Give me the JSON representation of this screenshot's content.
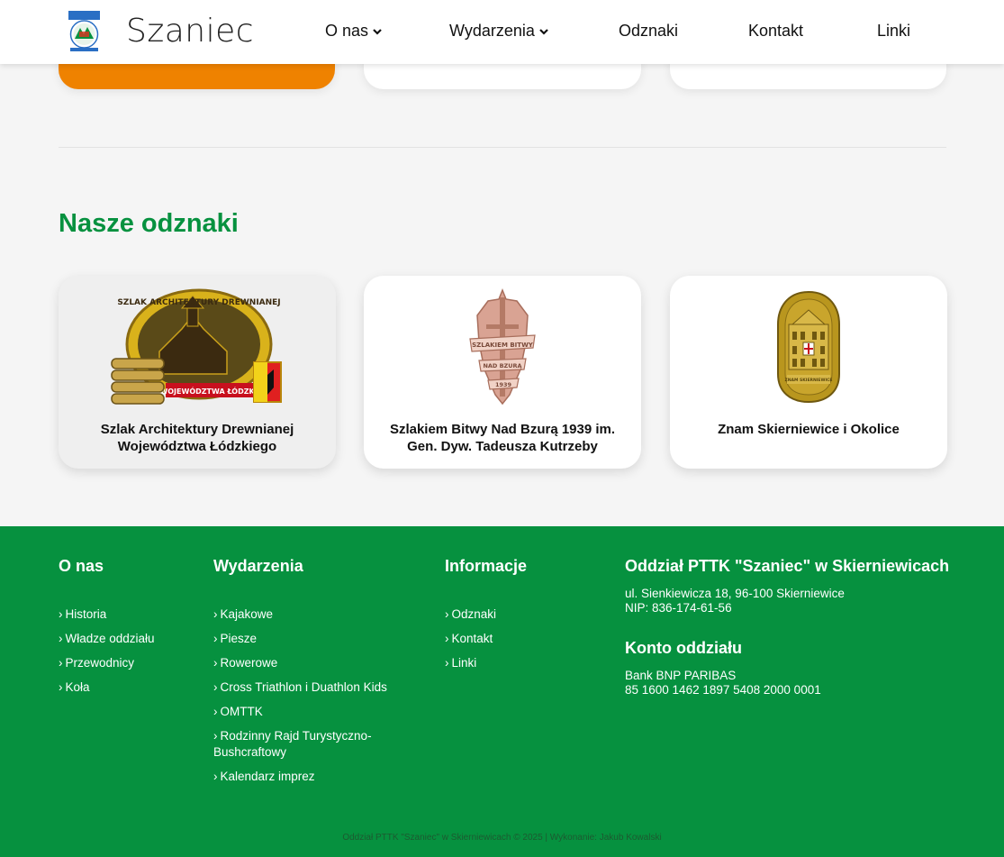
{
  "header": {
    "brand": "Szaniec",
    "nav": [
      {
        "label": "O nas",
        "dropdown": true
      },
      {
        "label": "Wydarzenia",
        "dropdown": true
      },
      {
        "label": "Odznaki",
        "dropdown": false
      },
      {
        "label": "Kontakt",
        "dropdown": false
      },
      {
        "label": "Linki",
        "dropdown": false
      }
    ]
  },
  "badges": {
    "title": "Nasze odznaki",
    "cards": [
      {
        "title": "Szlak Architektury Drewnianej Województwa Łódzkiego",
        "icon": "wooden-church-badge"
      },
      {
        "title": "Szlakiem Bitwy Nad Bzurą 1939 im. Gen. Dyw. Tadeusza Kutrzeby",
        "icon": "sword-banner-badge"
      },
      {
        "title": "Znam Skierniewice i Okolice",
        "icon": "town-hall-badge"
      }
    ]
  },
  "footer": {
    "col1": {
      "title": "O nas",
      "items": [
        "Historia",
        "Władze oddziału",
        "Przewodnicy",
        "Koła"
      ]
    },
    "col2": {
      "title": "Wydarzenia",
      "items": [
        "Kajakowe",
        "Piesze",
        "Rowerowe",
        "Cross Triathlon i Duathlon Kids",
        "OMTTK",
        "Rodzinny Rajd Turystyczno-Bushcraftowy",
        "Kalendarz imprez"
      ]
    },
    "col3": {
      "title": "Informacje",
      "items": [
        "Odznaki",
        "Kontakt",
        "Linki"
      ]
    },
    "col4": {
      "title": "Oddział PTTK \"Szaniec\" w Skierniewicach",
      "address": "ul. Sienkiewicza 18, 96-100 Skierniewice",
      "nip": "NIP: 836-174-61-56",
      "account_title": "Konto oddziału",
      "bank": "Bank BNP PARIBAS",
      "account": "85 1600 1462 1897 5408 2000 0001"
    },
    "copyright": "Oddział PTTK \"Szaniec\" w Skierniewicach © 2025 | Wykonanie: Jakub Kowalski"
  },
  "colors": {
    "green": "#06913f",
    "orange": "#ef8200"
  }
}
